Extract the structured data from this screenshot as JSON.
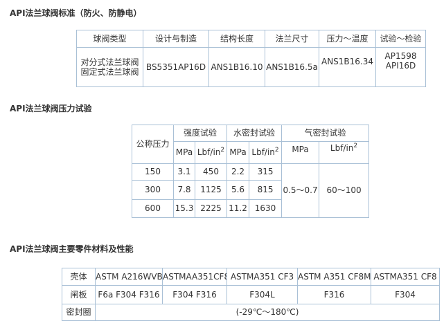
{
  "section1": {
    "title": "API法兰球阀标准（防火、防静电）",
    "headers": [
      "球阀类型",
      "设计与制造",
      "结构长度",
      "法兰尺寸",
      "压力～温度",
      "试验～检验"
    ],
    "row": {
      "type_line1": "对分式法兰球阀",
      "type_line2": "固定式法兰球阀",
      "design": "BS5351AP16D",
      "length": "ANS1B16.10",
      "flange": "ANS1B16.5a",
      "pt": "ANS1B16.34",
      "test_line1": "AP1598",
      "test_line2": "API16D"
    }
  },
  "section2": {
    "title": "API法兰球阀压力试验",
    "nominal_label": "公称压力",
    "groups": [
      "强度试验",
      "水密封试验",
      "气密封试验"
    ],
    "unit_mpa": "MPa",
    "unit_lbf": "Lbf/in",
    "unit_exp": "2",
    "rows": [
      {
        "nominal": "150",
        "s_mpa": "3.1",
        "s_lbf": "450",
        "w_mpa": "2.2",
        "w_lbf": "315"
      },
      {
        "nominal": "300",
        "s_mpa": "7.8",
        "s_lbf": "1125",
        "w_mpa": "5.6",
        "w_lbf": "815"
      },
      {
        "nominal": "600",
        "s_mpa": "15.3",
        "s_lbf": "2225",
        "w_mpa": "11.2",
        "w_lbf": "1630"
      }
    ],
    "air_mpa": "0.5～0.7",
    "air_lbf": "60～100"
  },
  "section3": {
    "title": "API法兰球阀主要零件材料及性能",
    "rows": [
      {
        "label": "壳体",
        "values": [
          "ASTM A216WVB",
          "ASTMAA351CF8",
          "ASTMA351 CF3",
          "ASTM A351 CF8M",
          "ASTMA351 CF8"
        ]
      },
      {
        "label": "闸板",
        "values": [
          "F6a F304 F316",
          "F304 F316",
          "F304L",
          "F316",
          "F304"
        ]
      }
    ],
    "seal_label": "密封圈",
    "seal_value": "(-29℃～180℃)"
  },
  "colors": {
    "border": "#a9c0d6",
    "text": "#333333"
  }
}
